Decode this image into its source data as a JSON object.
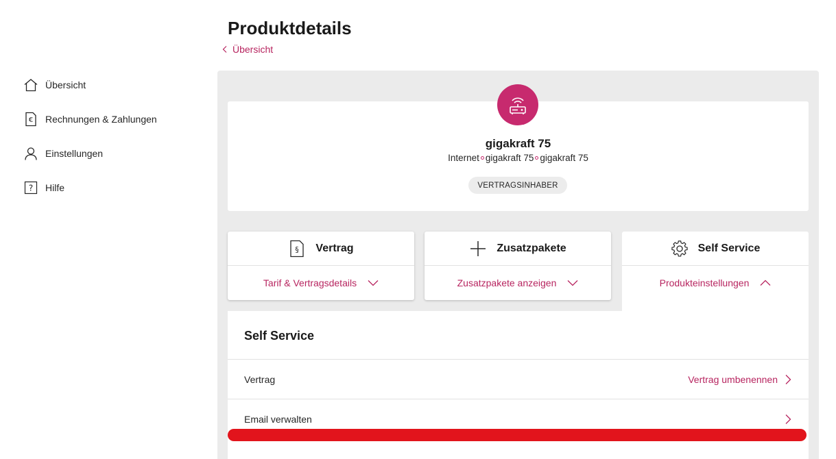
{
  "page": {
    "title": "Produktdetails",
    "breadcrumb": "Übersicht"
  },
  "sidebar": {
    "items": [
      {
        "label": "Übersicht",
        "icon": "home-icon"
      },
      {
        "label": "Rechnungen & Zahlungen",
        "icon": "invoice-icon"
      },
      {
        "label": "Einstellungen",
        "icon": "user-icon"
      },
      {
        "label": "Hilfe",
        "icon": "help-icon"
      }
    ]
  },
  "product": {
    "icon": "router-icon",
    "name": "gigakraft 75",
    "sub": [
      "Internet",
      "gigakraft 75",
      "gigakraft 75"
    ],
    "badge": "VERTRAGSINHABER"
  },
  "tiles": [
    {
      "title": "Vertrag",
      "icon": "contract-icon",
      "link": "Tarif & Vertragsdetails",
      "expanded": false
    },
    {
      "title": "Zusatzpakete",
      "icon": "plus-icon",
      "link": "Zusatzpakete anzeigen",
      "expanded": false
    },
    {
      "title": "Self Service",
      "icon": "gear-icon",
      "link": "Produkteinstellungen",
      "expanded": true
    }
  ],
  "self_service": {
    "title": "Self Service",
    "rows": [
      {
        "label": "Vertrag",
        "action": "Vertrag umbenennen"
      },
      {
        "label": "Email verwalten",
        "action": ""
      }
    ]
  },
  "colors": {
    "accent": "#b7245f",
    "brand": "#c72a6e",
    "panel_bg": "#ebebeb",
    "alert_bar": "#e2141c"
  }
}
